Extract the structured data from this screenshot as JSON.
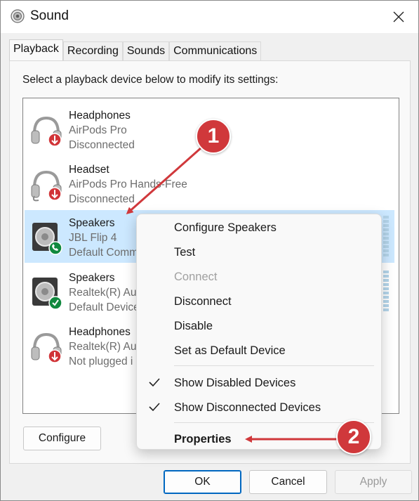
{
  "window": {
    "title": "Sound"
  },
  "tabs": [
    "Playback",
    "Recording",
    "Sounds",
    "Communications"
  ],
  "instruction": "Select a playback device below to modify its settings:",
  "devices": [
    {
      "name": "Headphones",
      "desc": "AirPods Pro",
      "status": "Disconnected",
      "icon": "headphones-icon",
      "badge": "disconnected-arrow-icon"
    },
    {
      "name": "Headset",
      "desc": "AirPods Pro Hands-Free",
      "status": "Disconnected",
      "icon": "headset-icon",
      "badge": "disconnected-arrow-icon"
    },
    {
      "name": "Speakers",
      "desc": "JBL Flip 4",
      "status": "Default Comm",
      "icon": "speaker-icon",
      "badge": "phone-icon",
      "selected": true
    },
    {
      "name": "Speakers",
      "desc": "Realtek(R) Au",
      "status": "Default Device",
      "icon": "speaker-icon",
      "badge": "checkmark-icon"
    },
    {
      "name": "Headphones",
      "desc": "Realtek(R) Au",
      "status": "Not plugged i",
      "icon": "headphones-icon",
      "badge": "disconnected-arrow-icon"
    }
  ],
  "context_menu": {
    "items": [
      {
        "label": "Configure Speakers",
        "enabled": true
      },
      {
        "label": "Test",
        "enabled": true
      },
      {
        "label": "Connect",
        "enabled": false
      },
      {
        "label": "Disconnect",
        "enabled": true
      },
      {
        "label": "Disable",
        "enabled": true
      },
      {
        "label": "Set as Default Device",
        "enabled": true
      },
      {
        "label": "Show Disabled Devices",
        "checked": true
      },
      {
        "label": "Show Disconnected Devices",
        "checked": true
      },
      {
        "label": "Properties",
        "bold": true
      }
    ]
  },
  "buttons": {
    "configure": "Configure",
    "ok": "OK",
    "cancel": "Cancel",
    "apply": "Apply"
  },
  "annotations": {
    "step1": "1",
    "step2": "2"
  },
  "colors": {
    "accent": "#0067c0",
    "selection": "#cce8ff",
    "annotation": "#d0383b",
    "badge_red": "#d13438",
    "badge_green": "#10893e"
  }
}
